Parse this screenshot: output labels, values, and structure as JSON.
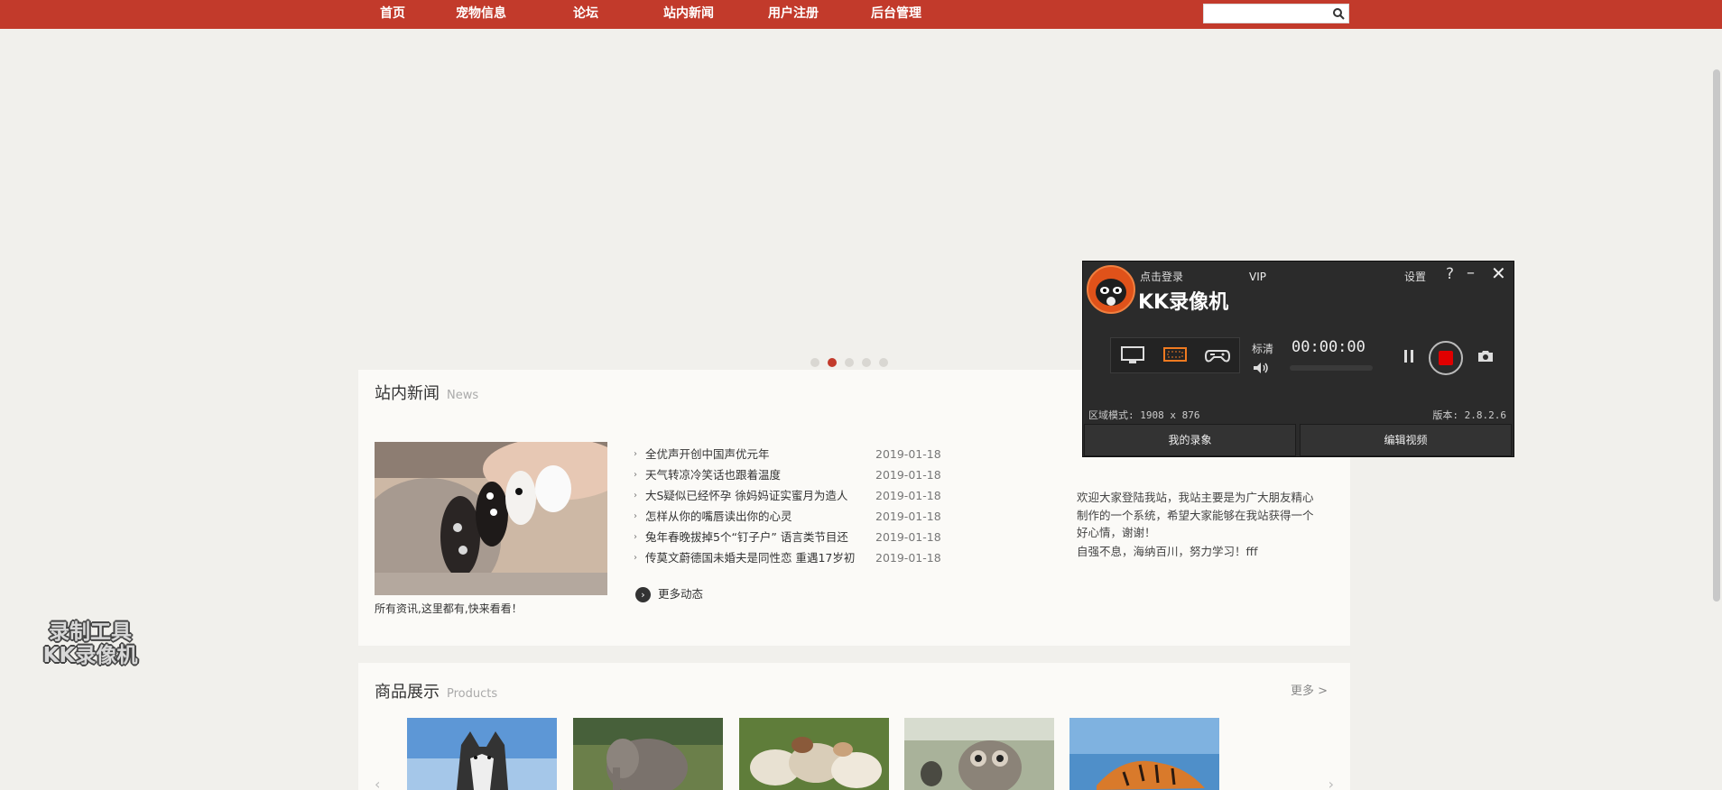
{
  "nav": {
    "items": [
      "首页",
      "宠物信息",
      "论坛",
      "站内新闻",
      "用户注册",
      "后台管理"
    ],
    "search_placeholder": ""
  },
  "banner": {
    "dot_count": 5,
    "active_dot": 2
  },
  "news": {
    "title": "站内新闻",
    "subtitle": "News",
    "image_caption": "所有资讯,这里都有,快来看看！",
    "items": [
      {
        "title": "全优声开创中国声优元年",
        "date": "2019-01-18"
      },
      {
        "title": "天气转凉冷笑话也跟着温度",
        "date": "2019-01-18"
      },
      {
        "title": "大S疑似已经怀孕 徐妈妈证实蜜月为造人",
        "date": "2019-01-18"
      },
      {
        "title": "怎样从你的嘴唇读出你的心灵",
        "date": "2019-01-18"
      },
      {
        "title": "兔年春晚拔掉5个“钉子户” 语言类节目还",
        "date": "2019-01-18"
      },
      {
        "title": "传莫文蔚德国未婚夫是同性恋 重遇17岁初",
        "date": "2019-01-18"
      }
    ],
    "more_label": "更多动态",
    "welcome_text": "欢迎大家登陆我站，我站主要是为广大朋友精心制作的一个系统，希望大家能够在我站获得一个好心情，谢谢！",
    "welcome_extra": "自强不息，海纳百川，努力学习！fff"
  },
  "products": {
    "title": "商品展示",
    "subtitle": "Products",
    "more_label": "更多 >",
    "items": [
      "husky",
      "elephant",
      "sheep",
      "owl",
      "tiger"
    ]
  },
  "watermark": {
    "line1": "录制工具",
    "line2": "KK录像机"
  },
  "recorder": {
    "login_label": "点击登录",
    "vip_label": "VIP",
    "brand": "KK录像机",
    "settings_label": "设置",
    "help_label": "?",
    "quality_label": "标清",
    "time": "00:00:00",
    "area_mode": "区域模式: 1908 x 876",
    "version": "版本: 2.8.2.6",
    "my_recordings_label": "我的录象",
    "edit_video_label": "编辑视频",
    "accent": "#e00000"
  }
}
